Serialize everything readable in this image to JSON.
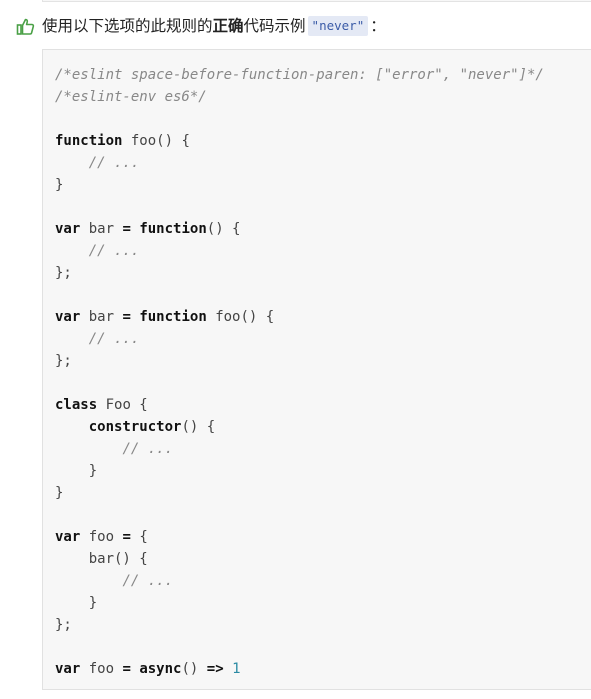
{
  "heading": {
    "prefix": "使用以下选项的此规则的",
    "bold": "正确",
    "middle": "代码示例",
    "option": "\"never\"",
    "suffix": "："
  },
  "icons": {
    "heading_icon": "thumbs-up-icon",
    "accent_color": "#4aa046"
  },
  "code": {
    "language": "javascript",
    "lines": [
      [
        {
          "t": "/*eslint space-before-function-paren: [\"error\", \"never\"]*/",
          "c": "cm"
        }
      ],
      [
        {
          "t": "/*eslint-env es6*/",
          "c": "cm"
        }
      ],
      [],
      [
        {
          "t": "function",
          "c": "kw"
        },
        {
          "t": " foo() {",
          "c": ""
        }
      ],
      [
        {
          "t": "    ",
          "c": ""
        },
        {
          "t": "// ...",
          "c": "cm"
        }
      ],
      [
        {
          "t": "}",
          "c": ""
        }
      ],
      [],
      [
        {
          "t": "var",
          "c": "kw"
        },
        {
          "t": " bar ",
          "c": ""
        },
        {
          "t": "=",
          "c": "kw"
        },
        {
          "t": " ",
          "c": ""
        },
        {
          "t": "function",
          "c": "kw"
        },
        {
          "t": "() {",
          "c": ""
        }
      ],
      [
        {
          "t": "    ",
          "c": ""
        },
        {
          "t": "// ...",
          "c": "cm"
        }
      ],
      [
        {
          "t": "};",
          "c": ""
        }
      ],
      [],
      [
        {
          "t": "var",
          "c": "kw"
        },
        {
          "t": " bar ",
          "c": ""
        },
        {
          "t": "=",
          "c": "kw"
        },
        {
          "t": " ",
          "c": ""
        },
        {
          "t": "function",
          "c": "kw"
        },
        {
          "t": " foo() {",
          "c": ""
        }
      ],
      [
        {
          "t": "    ",
          "c": ""
        },
        {
          "t": "// ...",
          "c": "cm"
        }
      ],
      [
        {
          "t": "};",
          "c": ""
        }
      ],
      [],
      [
        {
          "t": "class",
          "c": "kw"
        },
        {
          "t": " Foo {",
          "c": ""
        }
      ],
      [
        {
          "t": "    ",
          "c": ""
        },
        {
          "t": "constructor",
          "c": "kw"
        },
        {
          "t": "() {",
          "c": ""
        }
      ],
      [
        {
          "t": "        ",
          "c": ""
        },
        {
          "t": "// ...",
          "c": "cm"
        }
      ],
      [
        {
          "t": "    }",
          "c": ""
        }
      ],
      [
        {
          "t": "}",
          "c": ""
        }
      ],
      [],
      [
        {
          "t": "var",
          "c": "kw"
        },
        {
          "t": " foo ",
          "c": ""
        },
        {
          "t": "=",
          "c": "kw"
        },
        {
          "t": " {",
          "c": ""
        }
      ],
      [
        {
          "t": "    bar() {",
          "c": ""
        }
      ],
      [
        {
          "t": "        ",
          "c": ""
        },
        {
          "t": "// ...",
          "c": "cm"
        }
      ],
      [
        {
          "t": "    }",
          "c": ""
        }
      ],
      [
        {
          "t": "};",
          "c": ""
        }
      ],
      [],
      [
        {
          "t": "var",
          "c": "kw"
        },
        {
          "t": " foo ",
          "c": ""
        },
        {
          "t": "=",
          "c": "kw"
        },
        {
          "t": " ",
          "c": ""
        },
        {
          "t": "async",
          "c": "kw"
        },
        {
          "t": "() ",
          "c": ""
        },
        {
          "t": "=>",
          "c": "kw"
        },
        {
          "t": " ",
          "c": ""
        },
        {
          "t": "1",
          "c": "num"
        }
      ]
    ]
  }
}
